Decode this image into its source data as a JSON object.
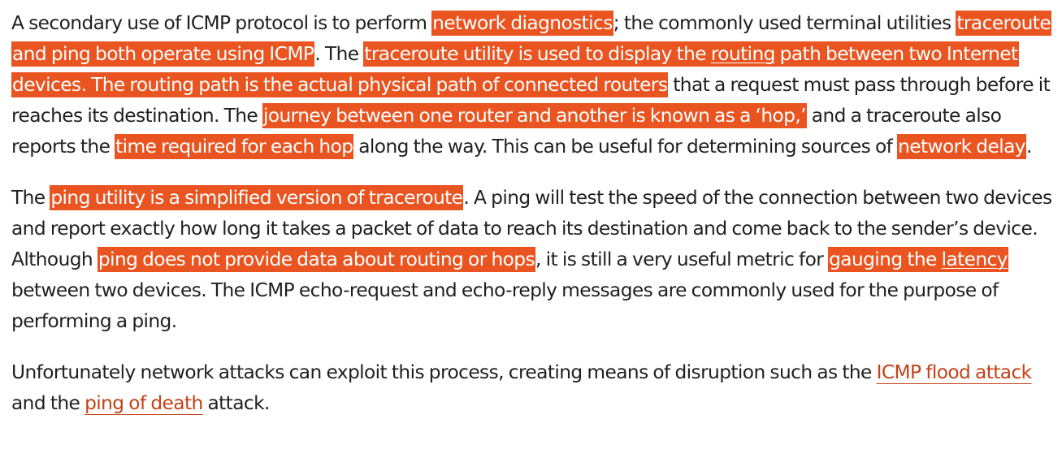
{
  "colors": {
    "highlight_background": "#e95420",
    "highlight_text": "#ffffff",
    "link_text": "#c44217",
    "body_text": "#1f1f1f"
  },
  "paragraphs": [
    {
      "segments": [
        "A secondary use of ICMP protocol is to perform ",
        "network diagnostics",
        "; the commonly used terminal utilities ",
        "traceroute and ping both operate using ICMP",
        ". The ",
        "traceroute utility is used to display the ",
        "routing",
        " path between two Internet devices. The routing path is the actual physical path of connected routers",
        " that a request must pass through before it reaches its destination. The ",
        "journey between one router and another is known as a ‘hop,’",
        " and a traceroute also reports the ",
        "time required for each hop",
        " along the way. This can be useful for determining sources of ",
        "network delay",
        "."
      ]
    },
    {
      "segments": [
        "The ",
        "ping utility is a simplified version of traceroute",
        ". A ping will test the speed of the connection between two devices and report exactly how long it takes a packet of data to reach its destination and come back to the sender’s device. Although ",
        "ping does not provide data about routing or hops",
        ", it is still a very useful metric for ",
        "gauging the ",
        "latency",
        " between two devices. The ICMP echo-request and echo-reply messages are commonly used for the purpose of performing a ping."
      ]
    },
    {
      "segments": [
        "Unfortunately network attacks can exploit this process, creating means of disruption such as the ",
        "ICMP flood attack",
        " and the ",
        "ping of death",
        " attack."
      ]
    }
  ]
}
